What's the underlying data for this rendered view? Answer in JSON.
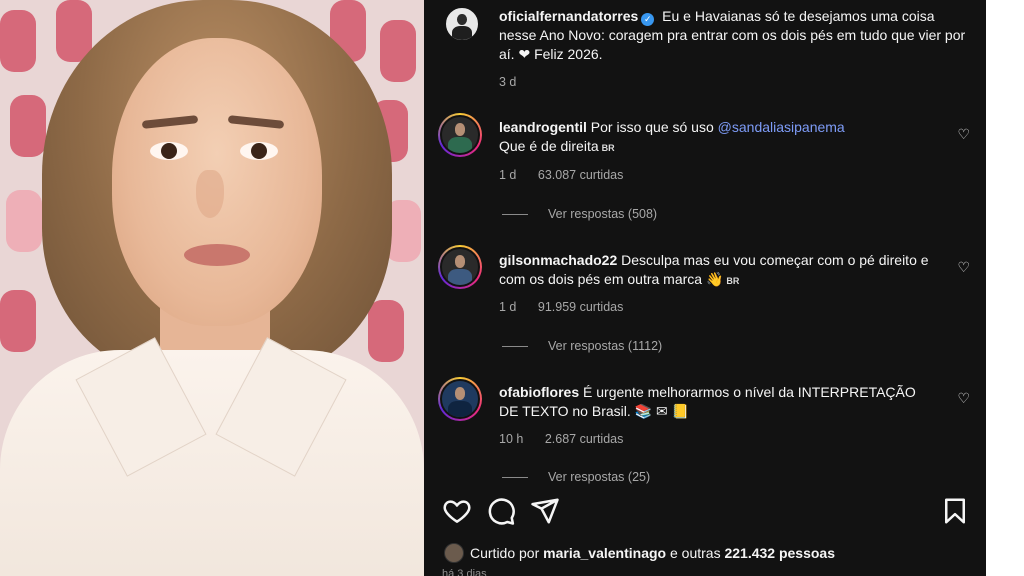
{
  "post": {
    "username": "oficialfernandatorres",
    "caption": "Eu e Havaianas só te desejamos uma coisa nesse Ano Novo: coragem pra entrar com os dois pés em tudo que vier por aí. ❤ Feliz 2026.",
    "time": "3 d"
  },
  "comments": [
    {
      "username": "leandrogentil",
      "text_before": "Por isso que só uso ",
      "mention": "@sandaliasipanema",
      "text_after": "Que é de direita",
      "flag": "BR",
      "time": "1 d",
      "likes": "63.087 curtidas",
      "replies": "Ver respostas (508)"
    },
    {
      "username": "gilsonmachado22",
      "text": "Desculpa mas eu vou começar com o pé direito e com os dois pés em outra marca 👋",
      "flag": "BR",
      "time": "1 d",
      "likes": "91.959 curtidas",
      "replies": "Ver respostas (1112)"
    },
    {
      "username": "ofabioflores",
      "text": "É urgente melhorarmos o nível da INTERPRETAÇÃO DE TEXTO no Brasil. 📚 ✉ 📒",
      "time": "10 h",
      "likes": "2.687 curtidas",
      "replies": "Ver respostas (25)"
    }
  ],
  "footer": {
    "liked_prefix": "Curtido por ",
    "liked_user": "maria_valentinago",
    "liked_suffix": " e outras ",
    "liked_count": "221.432 pessoas",
    "date_partial": "há 3 dias"
  },
  "icons": {
    "heart": "heart-icon",
    "comment": "comment-icon",
    "share": "share-icon",
    "bookmark": "bookmark-icon"
  },
  "colors": {
    "panel_bg": "#121212",
    "mention": "#7e9cf7",
    "verified": "#3897f0"
  }
}
